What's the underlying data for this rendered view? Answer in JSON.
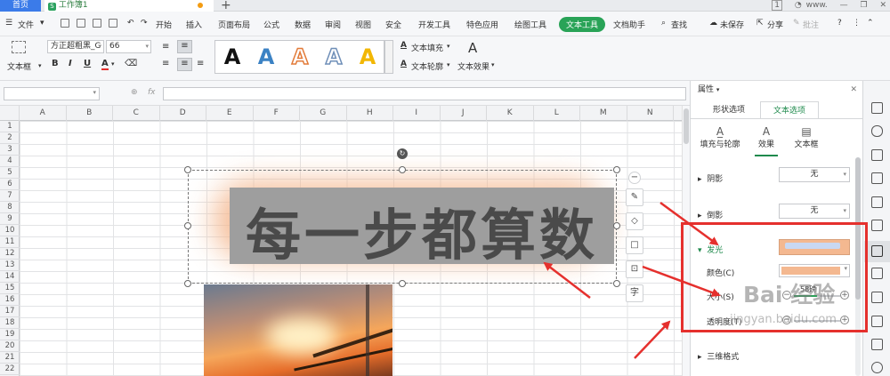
{
  "tabs": {
    "home": "首页",
    "doc": "工作簿1",
    "doc_logo": "S",
    "add": "+"
  },
  "window": {
    "page_badge": "1",
    "user": "www.",
    "minimize": "—",
    "restore": "❐",
    "close": "✕"
  },
  "menu": {
    "file": "文件",
    "items": [
      "开始",
      "插入",
      "页面布局",
      "公式",
      "数据",
      "审阅",
      "视图",
      "安全",
      "开发工具",
      "特色应用",
      "绘图工具"
    ],
    "active": "文本工具",
    "assistant": "文档助手",
    "search": "查找",
    "unsaved": "未保存",
    "share": "分享",
    "comment": "批注",
    "help": "?"
  },
  "ribbon": {
    "textbox": "文本框",
    "font_name": "方正超粗黑_G",
    "font_size": "66",
    "bold": "B",
    "italic": "I",
    "underline": "U",
    "font_color": "A",
    "wordart_glyph": "A",
    "text_fill": "文本填充",
    "text_outline": "文本轮廓",
    "text_effect": "文本效果"
  },
  "formula": {
    "fx": "fx"
  },
  "columns": [
    "A",
    "B",
    "C",
    "D",
    "E",
    "F",
    "G",
    "H",
    "I",
    "J",
    "K",
    "L",
    "M",
    "N"
  ],
  "rows": [
    "1",
    "2",
    "3",
    "4",
    "5",
    "6",
    "7",
    "8",
    "9",
    "10",
    "11",
    "12",
    "13",
    "14",
    "15",
    "16",
    "17",
    "18",
    "19",
    "20",
    "21",
    "22"
  ],
  "wordart_text": "每一步都算数",
  "pane": {
    "title": "属性",
    "close": "✕",
    "tab_shape": "形状选项",
    "tab_text": "文本选项",
    "sub_fill": "填充与轮廓",
    "sub_effect": "效果",
    "sub_textbox": "文本框",
    "shadow": "阴影",
    "shadow_value": "无",
    "reflection": "倒影",
    "reflection_value": "无",
    "glow": "发光",
    "color_label": "颜色(C)",
    "size_label": "大小(S)",
    "size_value": "58磅",
    "transparency_label": "透明度(T)",
    "three_d": "三维格式"
  },
  "watermark": "Bai 经验",
  "watermark_url": "jingyan.baidu.com",
  "colors": {
    "accent": "#29a357",
    "glow": "#f4b890",
    "highlight": "#e5302d",
    "home_tab": "#3b7be9"
  }
}
